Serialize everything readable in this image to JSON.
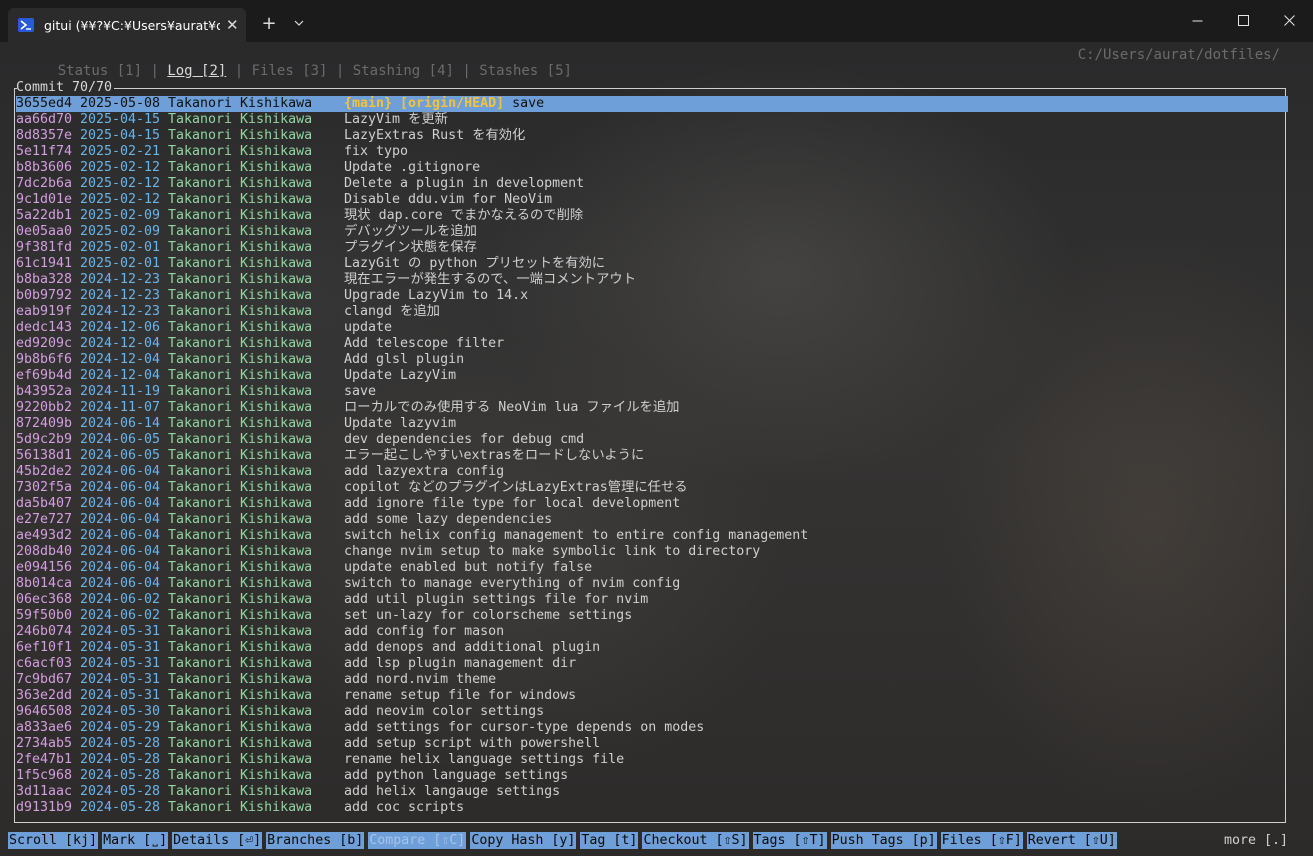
{
  "window": {
    "tab_title": "gitui (¥¥?¥C:¥Users¥aurat¥dot",
    "close_glyph": "✕",
    "new_tab_glyph": "+",
    "dropdown_glyph": "⌄"
  },
  "nav": {
    "tabs": [
      {
        "label": "Status [1]"
      },
      {
        "label": "Log [2]"
      },
      {
        "label": "Files [3]"
      },
      {
        "label": "Stashing [4]"
      },
      {
        "label": "Stashes [5]"
      }
    ],
    "separator": " | ",
    "path": "C:/Users/aurat/dotfiles/"
  },
  "panel": {
    "title": "Commit 70/70"
  },
  "commits": [
    {
      "hash": "3655ed4",
      "date": "2025-05-08",
      "author": "Takanori Kishikawa",
      "tags": "{main} [origin/HEAD]",
      "msg": "save"
    },
    {
      "hash": "aa66d70",
      "date": "2025-04-15",
      "author": "Takanori Kishikawa",
      "tags": "",
      "msg": "LazyVim を更新"
    },
    {
      "hash": "8d8357e",
      "date": "2025-04-15",
      "author": "Takanori Kishikawa",
      "tags": "",
      "msg": "LazyExtras Rust を有効化"
    },
    {
      "hash": "5e11f74",
      "date": "2025-02-21",
      "author": "Takanori Kishikawa",
      "tags": "",
      "msg": "fix typo"
    },
    {
      "hash": "b8b3606",
      "date": "2025-02-12",
      "author": "Takanori Kishikawa",
      "tags": "",
      "msg": "Update .gitignore"
    },
    {
      "hash": "7dc2b6a",
      "date": "2025-02-12",
      "author": "Takanori Kishikawa",
      "tags": "",
      "msg": "Delete a plugin in development"
    },
    {
      "hash": "9c1d01e",
      "date": "2025-02-12",
      "author": "Takanori Kishikawa",
      "tags": "",
      "msg": "Disable ddu.vim for NeoVim"
    },
    {
      "hash": "5a22db1",
      "date": "2025-02-09",
      "author": "Takanori Kishikawa",
      "tags": "",
      "msg": "現状 dap.core でまかなえるので削除"
    },
    {
      "hash": "0e05aa0",
      "date": "2025-02-09",
      "author": "Takanori Kishikawa",
      "tags": "",
      "msg": "デバッグツールを追加"
    },
    {
      "hash": "9f381fd",
      "date": "2025-02-01",
      "author": "Takanori Kishikawa",
      "tags": "",
      "msg": "プラグイン状態を保存"
    },
    {
      "hash": "61c1941",
      "date": "2025-02-01",
      "author": "Takanori Kishikawa",
      "tags": "",
      "msg": "LazyGit の python プリセットを有効に"
    },
    {
      "hash": "b8ba328",
      "date": "2024-12-23",
      "author": "Takanori Kishikawa",
      "tags": "",
      "msg": "現在エラーが発生するので、一端コメントアウト"
    },
    {
      "hash": "b0b9792",
      "date": "2024-12-23",
      "author": "Takanori Kishikawa",
      "tags": "",
      "msg": "Upgrade LazyVim to 14.x"
    },
    {
      "hash": "eab919f",
      "date": "2024-12-23",
      "author": "Takanori Kishikawa",
      "tags": "",
      "msg": "clangd を追加"
    },
    {
      "hash": "dedc143",
      "date": "2024-12-06",
      "author": "Takanori Kishikawa",
      "tags": "",
      "msg": "update"
    },
    {
      "hash": "ed9209c",
      "date": "2024-12-04",
      "author": "Takanori Kishikawa",
      "tags": "",
      "msg": "Add telescope filter"
    },
    {
      "hash": "9b8b6f6",
      "date": "2024-12-04",
      "author": "Takanori Kishikawa",
      "tags": "",
      "msg": "Add glsl plugin"
    },
    {
      "hash": "ef69b4d",
      "date": "2024-12-04",
      "author": "Takanori Kishikawa",
      "tags": "",
      "msg": "Update LazyVim"
    },
    {
      "hash": "b43952a",
      "date": "2024-11-19",
      "author": "Takanori Kishikawa",
      "tags": "",
      "msg": "save"
    },
    {
      "hash": "9220bb2",
      "date": "2024-11-07",
      "author": "Takanori Kishikawa",
      "tags": "",
      "msg": "ローカルでのみ使用する NeoVim lua ファイルを追加"
    },
    {
      "hash": "872409b",
      "date": "2024-06-14",
      "author": "Takanori Kishikawa",
      "tags": "",
      "msg": "Update lazyvim"
    },
    {
      "hash": "5d9c2b9",
      "date": "2024-06-05",
      "author": "Takanori Kishikawa",
      "tags": "",
      "msg": "dev dependencies for debug cmd"
    },
    {
      "hash": "56138d1",
      "date": "2024-06-05",
      "author": "Takanori Kishikawa",
      "tags": "",
      "msg": "エラー起こしやすいextrasをロードしないように"
    },
    {
      "hash": "45b2de2",
      "date": "2024-06-04",
      "author": "Takanori Kishikawa",
      "tags": "",
      "msg": "add lazyextra config"
    },
    {
      "hash": "7302f5a",
      "date": "2024-06-04",
      "author": "Takanori Kishikawa",
      "tags": "",
      "msg": "copilot などのプラグインはLazyExtras管理に任せる"
    },
    {
      "hash": "da5b407",
      "date": "2024-06-04",
      "author": "Takanori Kishikawa",
      "tags": "",
      "msg": "add ignore file type for local development"
    },
    {
      "hash": "e27e727",
      "date": "2024-06-04",
      "author": "Takanori Kishikawa",
      "tags": "",
      "msg": "add some lazy dependencies"
    },
    {
      "hash": "ae493d2",
      "date": "2024-06-04",
      "author": "Takanori Kishikawa",
      "tags": "",
      "msg": "switch helix config management to entire config management"
    },
    {
      "hash": "208db40",
      "date": "2024-06-04",
      "author": "Takanori Kishikawa",
      "tags": "",
      "msg": "change nvim setup to make symbolic link to directory"
    },
    {
      "hash": "e094156",
      "date": "2024-06-04",
      "author": "Takanori Kishikawa",
      "tags": "",
      "msg": "update enabled but notify false"
    },
    {
      "hash": "8b014ca",
      "date": "2024-06-04",
      "author": "Takanori Kishikawa",
      "tags": "",
      "msg": "switch to manage everything of nvim config"
    },
    {
      "hash": "06ec368",
      "date": "2024-06-02",
      "author": "Takanori Kishikawa",
      "tags": "",
      "msg": "add util plugin settings file for nvim"
    },
    {
      "hash": "59f50b0",
      "date": "2024-06-02",
      "author": "Takanori Kishikawa",
      "tags": "",
      "msg": "set un-lazy for colorscheme settings"
    },
    {
      "hash": "246b074",
      "date": "2024-05-31",
      "author": "Takanori Kishikawa",
      "tags": "",
      "msg": "add config for mason"
    },
    {
      "hash": "6ef10f1",
      "date": "2024-05-31",
      "author": "Takanori Kishikawa",
      "tags": "",
      "msg": "add denops and additional plugin"
    },
    {
      "hash": "c6acf03",
      "date": "2024-05-31",
      "author": "Takanori Kishikawa",
      "tags": "",
      "msg": "add lsp plugin management dir"
    },
    {
      "hash": "7c9bd67",
      "date": "2024-05-31",
      "author": "Takanori Kishikawa",
      "tags": "",
      "msg": "add nord.nvim theme"
    },
    {
      "hash": "363e2dd",
      "date": "2024-05-31",
      "author": "Takanori Kishikawa",
      "tags": "",
      "msg": "rename setup file for windows"
    },
    {
      "hash": "9646508",
      "date": "2024-05-30",
      "author": "Takanori Kishikawa",
      "tags": "",
      "msg": "add neovim color settings"
    },
    {
      "hash": "a833ae6",
      "date": "2024-05-29",
      "author": "Takanori Kishikawa",
      "tags": "",
      "msg": "add settings for cursor-type depends on modes"
    },
    {
      "hash": "2734ab5",
      "date": "2024-05-28",
      "author": "Takanori Kishikawa",
      "tags": "",
      "msg": "add setup script with powershell"
    },
    {
      "hash": "2fe47b1",
      "date": "2024-05-28",
      "author": "Takanori Kishikawa",
      "tags": "",
      "msg": "rename helix language settings file"
    },
    {
      "hash": "1f5c968",
      "date": "2024-05-28",
      "author": "Takanori Kishikawa",
      "tags": "",
      "msg": "add python language settings"
    },
    {
      "hash": "3d11aac",
      "date": "2024-05-28",
      "author": "Takanori Kishikawa",
      "tags": "",
      "msg": "add helix langauge settings"
    },
    {
      "hash": "d9131b9",
      "date": "2024-05-28",
      "author": "Takanori Kishikawa",
      "tags": "",
      "msg": "add coc scripts"
    }
  ],
  "commands": [
    {
      "label": "Scroll [kj]",
      "enabled": true
    },
    {
      "label": "Mark [˽]",
      "enabled": true
    },
    {
      "label": "Details [⏎]",
      "enabled": true
    },
    {
      "label": "Branches [b]",
      "enabled": true
    },
    {
      "label": "Compare [⇧C]",
      "enabled": false
    },
    {
      "label": "Copy Hash [y]",
      "enabled": true
    },
    {
      "label": "Tag [t]",
      "enabled": true
    },
    {
      "label": "Checkout [⇧S]",
      "enabled": true
    },
    {
      "label": "Tags [⇧T]",
      "enabled": true
    },
    {
      "label": "Push Tags [p]",
      "enabled": true
    },
    {
      "label": "Files [⇧F]",
      "enabled": true
    },
    {
      "label": "Revert [⇧U]",
      "enabled": true
    }
  ],
  "more_label": "more [.]",
  "colors": {
    "selection": "#6e9fd8",
    "hash": "#d59ee0",
    "date": "#6ab4e8",
    "author": "#8fd6a0",
    "tags": "#f3c23a"
  }
}
